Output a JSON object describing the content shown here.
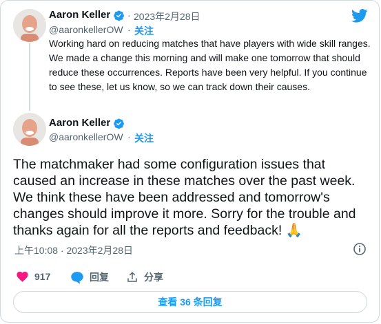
{
  "quoted_tweet": {
    "author_name": "Aaron Keller",
    "dot": "·",
    "date": "2023年2月28日",
    "handle": "@aaronkellerOW",
    "follow_sep": "·",
    "follow_label": "关注",
    "text": "Working hard on reducing matches that have players with wide skill ranges. We made a change this morning and will make one tomorrow that should reduce these occurrences. Reports have been very helpful. If you continue to see these, let us know, so we can track down their causes."
  },
  "main_tweet": {
    "author_name": "Aaron Keller",
    "handle": "@aaronkellerOW",
    "follow_sep": "·",
    "follow_label": "关注",
    "text": "The matchmaker had some configuration issues that caused an increase in these matches over the past week. We think these have been addressed and tomorrow's changes should improve it more. Sorry for the trouble and thanks again for all the reports and feedback! 🙏",
    "timestamp": "上午10:08 · 2023年2月28日"
  },
  "actions": {
    "like_count": "917",
    "reply_label": "回复",
    "share_label": "分享"
  },
  "view_replies_label": "查看 36 条回复",
  "colors": {
    "accent": "#1d9bf0",
    "like": "#f91880",
    "text": "#0f1419",
    "muted": "#536471",
    "border": "#cfd9de"
  }
}
